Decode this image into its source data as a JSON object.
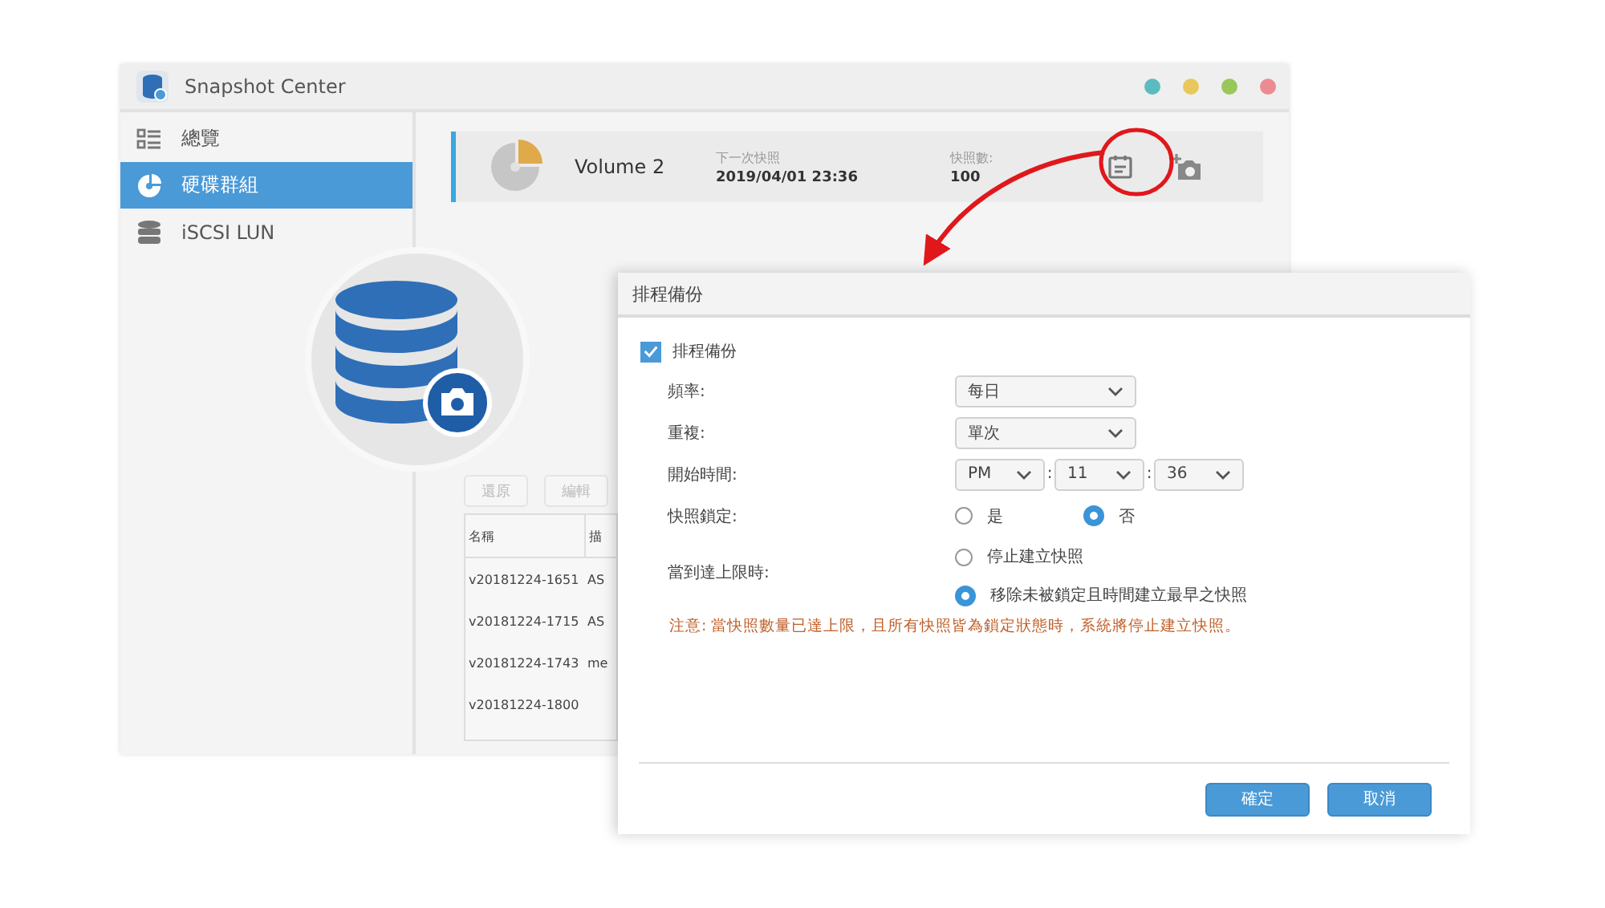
{
  "window": {
    "title": "Snapshot Center",
    "controls": [
      {
        "color": "#5bbcc0"
      },
      {
        "color": "#e8c85a"
      },
      {
        "color": "#98c85a"
      },
      {
        "color": "#ec8c92"
      }
    ]
  },
  "sidebar": {
    "items": [
      {
        "label": "總覽",
        "selected": false
      },
      {
        "label": "硬碟群組",
        "selected": true
      },
      {
        "label": "iSCSI LUN",
        "selected": false
      }
    ]
  },
  "volume_card": {
    "name": "Volume 2",
    "next_label": "下一次快照",
    "next_value": "2019/04/01 23:36",
    "count_label": "快照數:",
    "count_value": "100"
  },
  "toolbar": [
    {
      "label": "還原",
      "disabled": true
    },
    {
      "label": "編輯",
      "disabled": true
    }
  ],
  "table": {
    "columns": [
      "名稱",
      "描"
    ],
    "rows": [
      [
        "v20181224-1651",
        "AS"
      ],
      [
        "v20181224-1715",
        "AS"
      ],
      [
        "v20181224-1743",
        "me"
      ],
      [
        "v20181224-1800",
        ""
      ]
    ]
  },
  "dialog": {
    "title": "排程備份",
    "enable": {
      "label": "排程備份",
      "checked": true
    },
    "fields": [
      {
        "kind": "select",
        "label": "頻率:",
        "values": [
          "每日"
        ]
      },
      {
        "kind": "select",
        "label": "重複:",
        "values": [
          "單次"
        ]
      },
      {
        "kind": "time",
        "label": "開始時間:",
        "values": [
          "PM",
          "11",
          "36"
        ],
        "separator": ":"
      },
      {
        "kind": "radio-inline",
        "label": "快照鎖定:",
        "options": [
          {
            "label": "是",
            "selected": false
          },
          {
            "label": "否",
            "selected": true
          }
        ]
      },
      {
        "kind": "radio-stack",
        "label": "當到達上限時:",
        "options": [
          {
            "label": "停止建立快照",
            "selected": false
          },
          {
            "label": "移除未被鎖定且時間建立最早之快照",
            "selected": true
          }
        ]
      }
    ],
    "note": "注意: 當快照數量已達上限，且所有快照皆為鎖定狀態時，系統將停止建立快照。",
    "buttons": [
      "確定",
      "取消"
    ]
  }
}
